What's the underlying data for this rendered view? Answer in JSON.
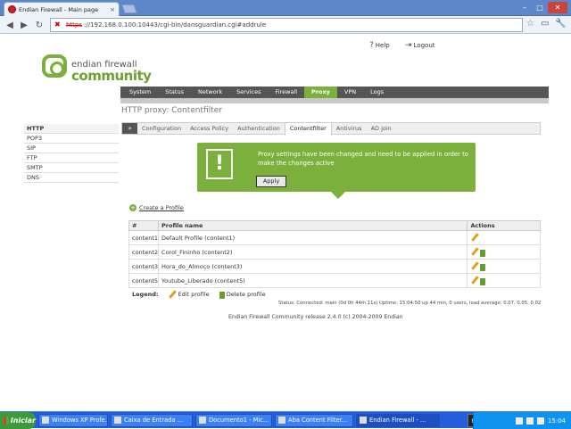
{
  "browser": {
    "tab_title": "Endian Firewall - Main page",
    "tab_close": "×",
    "url_lock": "✖",
    "url_scheme": "https",
    "url_rest": "://192.168.0.100:10443/cgi-bin/dansguardian.cgi#addrule",
    "back": "◀",
    "forward": "▶",
    "reload": "↻",
    "star": "☆",
    "page_menu": "▭",
    "wrench": "🔧",
    "win_min": "–",
    "win_max": "□",
    "win_close": "✕"
  },
  "header": {
    "logo_brand": "endian firewall",
    "logo_community": "community",
    "help_label": "Help",
    "logout_label": "Logout",
    "help_icon": "?",
    "logout_icon": "⇥"
  },
  "menu": [
    "System",
    "Status",
    "Network",
    "Services",
    "Firewall",
    "Proxy",
    "VPN",
    "Logs"
  ],
  "menu_active": "Proxy",
  "left_nav": [
    "HTTP",
    "POP3",
    "SIP",
    "FTP",
    "SMTP",
    "DNS"
  ],
  "page_title": "HTTP proxy: Contentfilter",
  "tabs": {
    "arrow": "»",
    "items": [
      "Configuration",
      "Access Policy",
      "Authentication",
      "Contentfilter",
      "Antivirus",
      "AD join"
    ],
    "active": "Contentfilter"
  },
  "notice": {
    "icon": "!",
    "text": "Proxy settings have been changed and need to be applied in order to make the changes active",
    "apply": "Apply"
  },
  "create_profile": {
    "icon": "+",
    "label": "Create a Profile"
  },
  "table": {
    "headers": [
      "#",
      "Profile name",
      "Actions"
    ],
    "rows": [
      {
        "id": "content1",
        "name": "Default Profile (content1)",
        "deletable": false
      },
      {
        "id": "content2",
        "name": "Corol_Fininho (content2)",
        "deletable": true
      },
      {
        "id": "content3",
        "name": "Hora_do_Almoço (content3)",
        "deletable": true
      },
      {
        "id": "content5",
        "name": "Youtube_Liberado (content5)",
        "deletable": true
      }
    ]
  },
  "legend": {
    "label": "Legend:",
    "edit": "Edit profile",
    "delete": "Delete profile"
  },
  "status": "Status: Connected: main (0d 0h 44m 11s) Uptime: 15:04:50 up 44 min, 0 users, load average: 0.07, 0.05, 0.02",
  "footer": "Endian Firewall Community release 2.4.0 (c) 2004-2009 Endian",
  "taskbar": {
    "start": "Iniciar",
    "tasks": [
      {
        "label": "Windows XP Profe...",
        "w": 78
      },
      {
        "label": "Caixa de Entrada ...",
        "w": 92
      },
      {
        "label": "Documento1 - Mic...",
        "w": 86
      },
      {
        "label": "Aba Content Filter...",
        "w": 88
      },
      {
        "label": "Endian Firewall - ...",
        "w": 94,
        "active": true
      }
    ],
    "pt": "PT",
    "clock": "15:04"
  }
}
